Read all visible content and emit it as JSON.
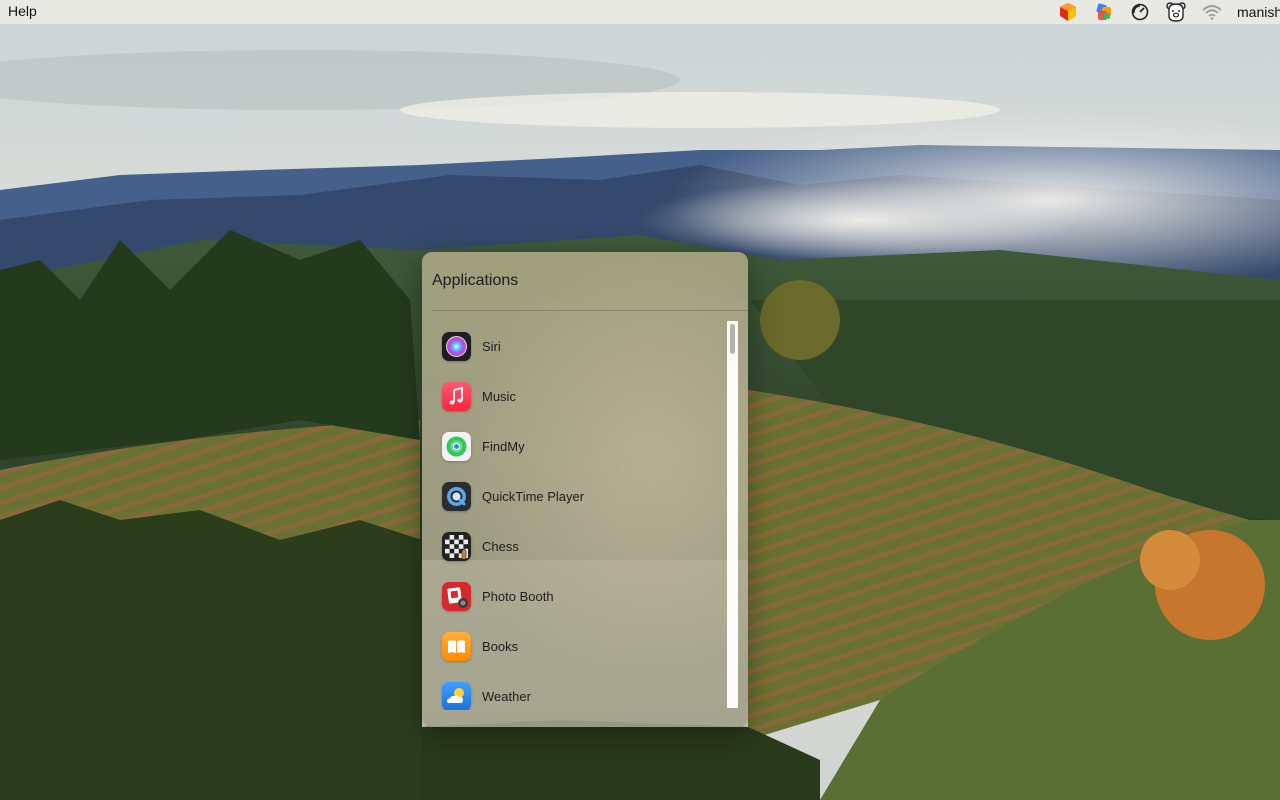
{
  "menubar": {
    "help_label": "Help",
    "username": "manish",
    "status_icons": [
      "boxes-app-icon",
      "colorful-stack-icon",
      "gauge-icon",
      "bear-icon",
      "wifi-icon"
    ]
  },
  "panel": {
    "title": "Applications",
    "apps": [
      {
        "label": "Siri",
        "icon": "siri-icon"
      },
      {
        "label": "Music",
        "icon": "music-icon"
      },
      {
        "label": "FindMy",
        "icon": "findmy-icon"
      },
      {
        "label": "QuickTime Player",
        "icon": "quicktime-icon"
      },
      {
        "label": "Chess",
        "icon": "chess-icon"
      },
      {
        "label": "Photo Booth",
        "icon": "photo-booth-icon"
      },
      {
        "label": "Books",
        "icon": "books-icon"
      },
      {
        "label": "Weather",
        "icon": "weather-icon"
      }
    ]
  },
  "colors": {
    "menubar_bg": "#ECEAE4",
    "panel_bg": "#A9A682",
    "music_red": "#FA3E55",
    "books_orange": "#FF9500",
    "weather_blue": "#2E8BF0"
  }
}
